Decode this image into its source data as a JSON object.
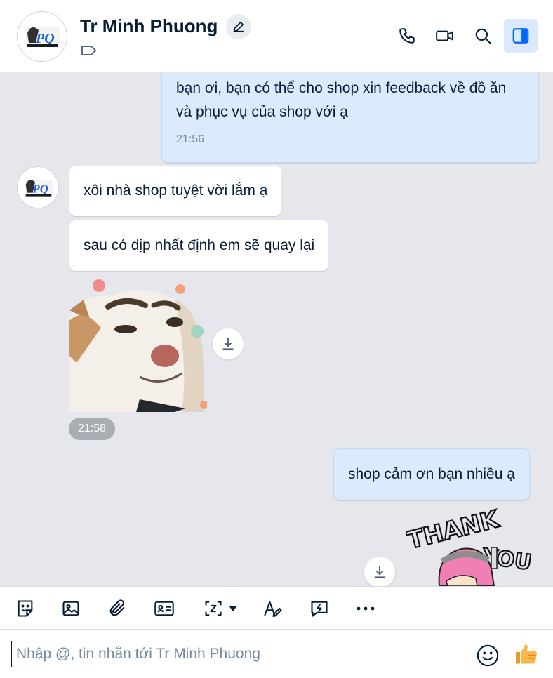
{
  "header": {
    "contact_name": "Tr Minh Phuong",
    "avatar_monogram": "PQ"
  },
  "messages": [
    {
      "direction": "out",
      "text": "bạn ơi, bạn có thể cho shop xin feedback về đồ ăn và phục vụ của shop với ạ",
      "time": "21:56"
    },
    {
      "direction": "in",
      "text": "xôi nhà shop tuyệt vời lắm ạ"
    },
    {
      "direction": "in",
      "text": "sau có dịp nhất định em sẽ quay lại"
    },
    {
      "direction": "in",
      "type": "sticker",
      "sticker": "dog-sticker",
      "time": "21:58"
    },
    {
      "direction": "out",
      "text": "shop cảm ơn bạn nhiều ạ"
    },
    {
      "direction": "out",
      "type": "sticker",
      "sticker": "thank-you-sticker",
      "sticker_text": [
        "THANK",
        "YOU"
      ]
    }
  ],
  "composer": {
    "placeholder": "Nhập @, tin nhắn tới Tr Minh Phuong"
  },
  "colors": {
    "accent": "#0068ff",
    "outgoing_bubble": "#dbebfc",
    "incoming_bubble": "#ffffff",
    "chat_background": "#e6e7ec"
  }
}
